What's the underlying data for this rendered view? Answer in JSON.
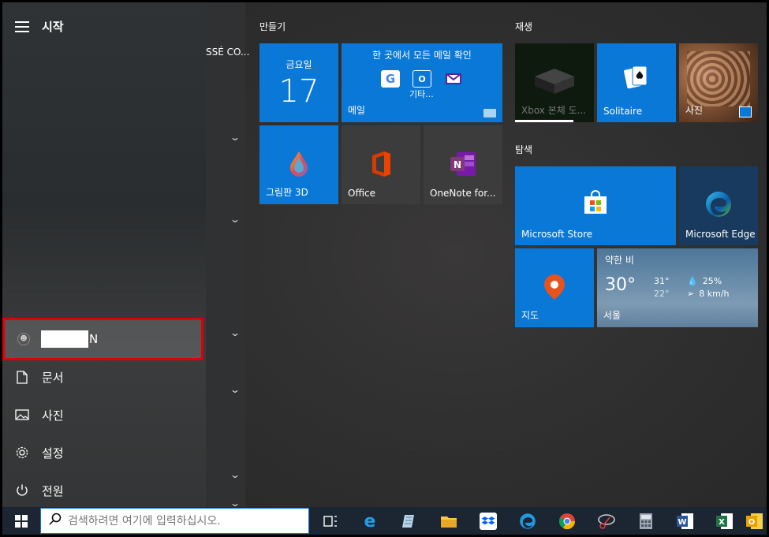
{
  "start": {
    "title": "시작",
    "app_list_visible_label": "SSÉ CO..."
  },
  "sidebar": {
    "user_suffix": "N",
    "items": [
      {
        "label": "문서",
        "icon": "document-icon"
      },
      {
        "label": "사진",
        "icon": "pictures-icon"
      },
      {
        "label": "설정",
        "icon": "settings-gear-icon"
      },
      {
        "label": "전원",
        "icon": "power-icon"
      }
    ]
  },
  "groups": {
    "create": "만들기",
    "play": "재생",
    "explore": "탐색"
  },
  "tiles": {
    "calendar": {
      "day": "금요일",
      "date": "17"
    },
    "mail": {
      "header": "한 곳에서 모든 메일 확인",
      "more": "기타...",
      "label": "메일"
    },
    "paint3d": {
      "label": "그림판 3D"
    },
    "office": {
      "label": "Office"
    },
    "onenote": {
      "label": "OneNote for..."
    },
    "xbox": {
      "label": "Xbox 본체 도..."
    },
    "solitaire": {
      "label": "Solitaire"
    },
    "photos": {
      "label": "사진"
    },
    "store": {
      "label": "Microsoft Store"
    },
    "edge": {
      "label": "Microsoft Edge"
    },
    "maps": {
      "label": "지도"
    },
    "weather": {
      "condition": "약한 비",
      "temp": "30°",
      "high": "31°",
      "low": "22°",
      "precip": "25%",
      "wind": "8 km/h",
      "city": "서울"
    }
  },
  "taskbar": {
    "search_placeholder": "검색하려면 여기에 입력하십시오.",
    "accent": "#0a78d7"
  }
}
